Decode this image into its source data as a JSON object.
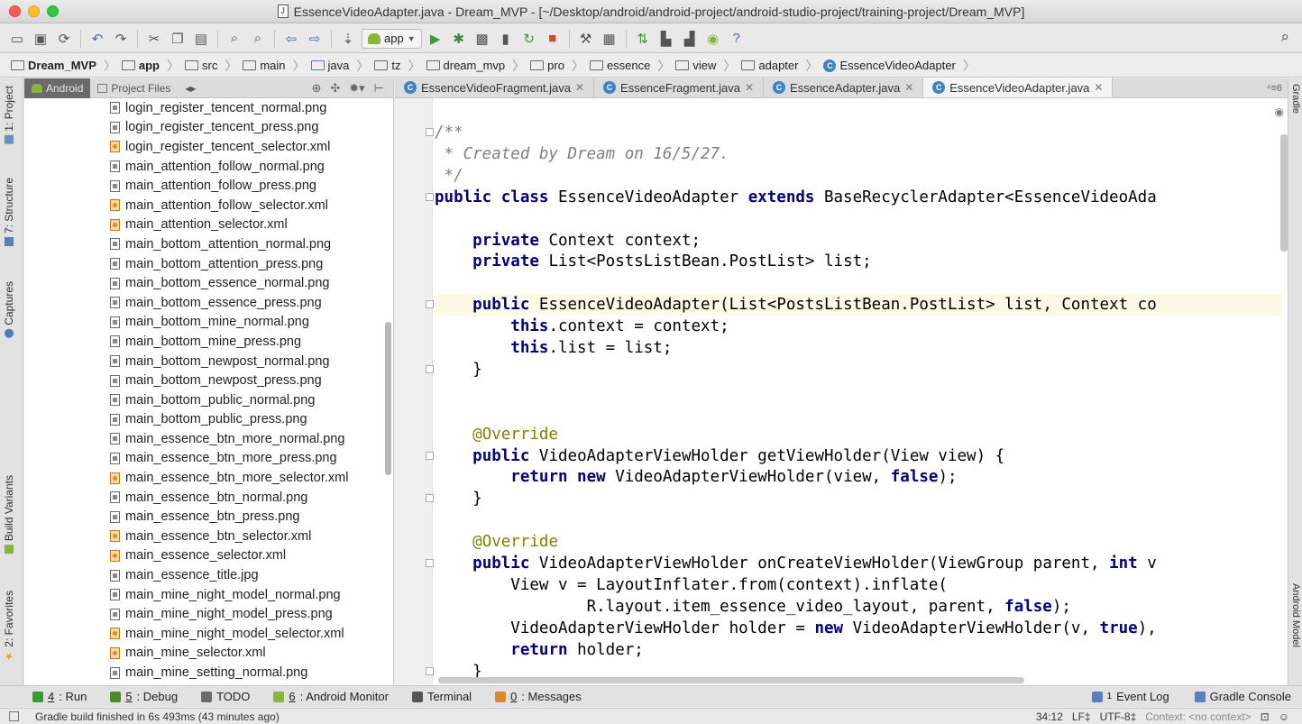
{
  "window": {
    "title": "EssenceVideoAdapter.java - Dream_MVP - [~/Desktop/android/android-project/android-studio-project/training-project/Dream_MVP]"
  },
  "toolbar": {
    "run_config": "app",
    "icons": [
      "folder-icon",
      "save-icon",
      "sync-icon",
      "undo-icon",
      "redo-icon",
      "cut-icon",
      "copy-icon",
      "paste-icon",
      "find-icon",
      "replace-icon",
      "back-icon",
      "forward-icon",
      "build-icon",
      "run-icon",
      "debug-icon",
      "coverage-icon",
      "attach-debugger-icon",
      "apply-changes-icon",
      "stop-icon",
      "sdk-icon",
      "structure-icon",
      "gradle-sync-icon",
      "avd-icon",
      "device-monitor-icon",
      "android-icon",
      "help-icon",
      "search-icon"
    ]
  },
  "breadcrumb": [
    "Dream_MVP",
    "app",
    "src",
    "main",
    "java",
    "tz",
    "dream_mvp",
    "pro",
    "essence",
    "view",
    "adapter",
    "EssenceVideoAdapter"
  ],
  "left_strip": [
    "1: Project",
    "7: Structure",
    "Captures",
    "Build Variants",
    "2: Favorites"
  ],
  "right_strip": [
    "Gradle",
    "Android Model"
  ],
  "project_panel": {
    "tabs": [
      "Android",
      "Project Files"
    ],
    "files": [
      {
        "name": "login_register_tencent_normal.png",
        "type": "png"
      },
      {
        "name": "login_register_tencent_press.png",
        "type": "png"
      },
      {
        "name": "login_register_tencent_selector.xml",
        "type": "xml"
      },
      {
        "name": "main_attention_follow_normal.png",
        "type": "png"
      },
      {
        "name": "main_attention_follow_press.png",
        "type": "png"
      },
      {
        "name": "main_attention_follow_selector.xml",
        "type": "xml"
      },
      {
        "name": "main_attention_selector.xml",
        "type": "xml"
      },
      {
        "name": "main_bottom_attention_normal.png",
        "type": "png"
      },
      {
        "name": "main_bottom_attention_press.png",
        "type": "png"
      },
      {
        "name": "main_bottom_essence_normal.png",
        "type": "png"
      },
      {
        "name": "main_bottom_essence_press.png",
        "type": "png"
      },
      {
        "name": "main_bottom_mine_normal.png",
        "type": "png"
      },
      {
        "name": "main_bottom_mine_press.png",
        "type": "png"
      },
      {
        "name": "main_bottom_newpost_normal.png",
        "type": "png"
      },
      {
        "name": "main_bottom_newpost_press.png",
        "type": "png"
      },
      {
        "name": "main_bottom_public_normal.png",
        "type": "png"
      },
      {
        "name": "main_bottom_public_press.png",
        "type": "png"
      },
      {
        "name": "main_essence_btn_more_normal.png",
        "type": "png"
      },
      {
        "name": "main_essence_btn_more_press.png",
        "type": "png"
      },
      {
        "name": "main_essence_btn_more_selector.xml",
        "type": "xml"
      },
      {
        "name": "main_essence_btn_normal.png",
        "type": "png"
      },
      {
        "name": "main_essence_btn_press.png",
        "type": "png"
      },
      {
        "name": "main_essence_btn_selector.xml",
        "type": "xml"
      },
      {
        "name": "main_essence_selector.xml",
        "type": "xml"
      },
      {
        "name": "main_essence_title.jpg",
        "type": "png"
      },
      {
        "name": "main_mine_night_model_normal.png",
        "type": "png"
      },
      {
        "name": "main_mine_night_model_press.png",
        "type": "png"
      },
      {
        "name": "main_mine_night_model_selector.xml",
        "type": "xml"
      },
      {
        "name": "main_mine_selector.xml",
        "type": "xml"
      },
      {
        "name": "main_mine_setting_normal.png",
        "type": "png"
      }
    ]
  },
  "editor": {
    "tabs": [
      {
        "label": "EssenceVideoFragment.java",
        "active": false
      },
      {
        "label": "EssenceFragment.java",
        "active": false
      },
      {
        "label": "EssenceAdapter.java",
        "active": false
      },
      {
        "label": "EssenceVideoAdapter.java",
        "active": true
      }
    ],
    "tabs_more": "⁴≡6",
    "code": [
      {
        "t": "/**",
        "cls": "comment"
      },
      {
        "t": " * Created by Dream on 16/5/27.",
        "cls": "comment"
      },
      {
        "t": " */",
        "cls": "comment"
      },
      {
        "parts": [
          {
            "t": "public class ",
            "k": 1
          },
          {
            "t": "EssenceVideoAdapter "
          },
          {
            "t": "extends ",
            "k": 1
          },
          {
            "t": "BaseRecyclerAdapter<EssenceVideoAda"
          }
        ]
      },
      {
        "t": ""
      },
      {
        "parts": [
          {
            "t": "    "
          },
          {
            "t": "private ",
            "k": 1
          },
          {
            "t": "Context context;"
          }
        ]
      },
      {
        "parts": [
          {
            "t": "    "
          },
          {
            "t": "private ",
            "k": 1
          },
          {
            "t": "List<PostsListBean.PostList> list;"
          }
        ]
      },
      {
        "t": ""
      },
      {
        "parts": [
          {
            "t": "    "
          },
          {
            "t": "public ",
            "k": 1
          },
          {
            "t": "EssenceVideoAdapter(List<PostsListBean.PostList> list, Context co"
          }
        ],
        "caret": true
      },
      {
        "parts": [
          {
            "t": "        "
          },
          {
            "t": "this",
            "k": 1
          },
          {
            "t": ".context = context;"
          }
        ]
      },
      {
        "parts": [
          {
            "t": "        "
          },
          {
            "t": "this",
            "k": 1
          },
          {
            "t": ".list = list;"
          }
        ]
      },
      {
        "t": "    }"
      },
      {
        "t": ""
      },
      {
        "t": ""
      },
      {
        "parts": [
          {
            "t": "    "
          },
          {
            "t": "@Override",
            "a": 1
          }
        ]
      },
      {
        "parts": [
          {
            "t": "    "
          },
          {
            "t": "public ",
            "k": 1
          },
          {
            "t": "VideoAdapterViewHolder getViewHolder(View view) {"
          }
        ]
      },
      {
        "parts": [
          {
            "t": "        "
          },
          {
            "t": "return new ",
            "k": 1
          },
          {
            "t": "VideoAdapterViewHolder(view, "
          },
          {
            "t": "false",
            "k": 1
          },
          {
            "t": ");"
          }
        ]
      },
      {
        "t": "    }"
      },
      {
        "t": ""
      },
      {
        "parts": [
          {
            "t": "    "
          },
          {
            "t": "@Override",
            "a": 1
          }
        ]
      },
      {
        "parts": [
          {
            "t": "    "
          },
          {
            "t": "public ",
            "k": 1
          },
          {
            "t": "VideoAdapterViewHolder onCreateViewHolder(ViewGroup parent, "
          },
          {
            "t": "int ",
            "k": 1
          },
          {
            "t": "v"
          }
        ]
      },
      {
        "t": "        View v = LayoutInflater.from(context).inflate("
      },
      {
        "parts": [
          {
            "t": "                R.layout.item_essence_video_layout, parent, "
          },
          {
            "t": "false",
            "k": 1
          },
          {
            "t": ");"
          }
        ]
      },
      {
        "parts": [
          {
            "t": "        VideoAdapterViewHolder holder = "
          },
          {
            "t": "new ",
            "k": 1
          },
          {
            "t": "VideoAdapterViewHolder(v, "
          },
          {
            "t": "true",
            "k": 1
          },
          {
            "t": "),"
          }
        ]
      },
      {
        "parts": [
          {
            "t": "        "
          },
          {
            "t": "return ",
            "k": 1
          },
          {
            "t": "holder;"
          }
        ]
      },
      {
        "t": "    }"
      }
    ]
  },
  "bottom_tools": [
    {
      "num": "4",
      "label": ": Run",
      "icon": "run-icon",
      "color": "#3a9a3a"
    },
    {
      "num": "5",
      "label": ": Debug",
      "icon": "debug-icon",
      "color": "#4a8a2a"
    },
    {
      "num": "",
      "label": "TODO",
      "icon": "todo-icon",
      "color": "#6a6a6a"
    },
    {
      "num": "6",
      "label": ": Android Monitor",
      "icon": "android-monitor-icon",
      "color": "#8ab43c"
    },
    {
      "num": "",
      "label": "Terminal",
      "icon": "terminal-icon",
      "color": "#555555"
    },
    {
      "num": "0",
      "label": ": Messages",
      "icon": "messages-icon",
      "color": "#d98a2a"
    }
  ],
  "bottom_right_tools": [
    {
      "label": "Event Log",
      "icon": "event-log-icon",
      "num": "1"
    },
    {
      "label": "Gradle Console",
      "icon": "gradle-console-icon",
      "num": ""
    }
  ],
  "status": {
    "message": "Gradle build finished in 6s 493ms (43 minutes ago)",
    "position": "34:12",
    "line_sep": "LF‡",
    "encoding": "UTF-8‡",
    "context": "Context: <no context>"
  }
}
